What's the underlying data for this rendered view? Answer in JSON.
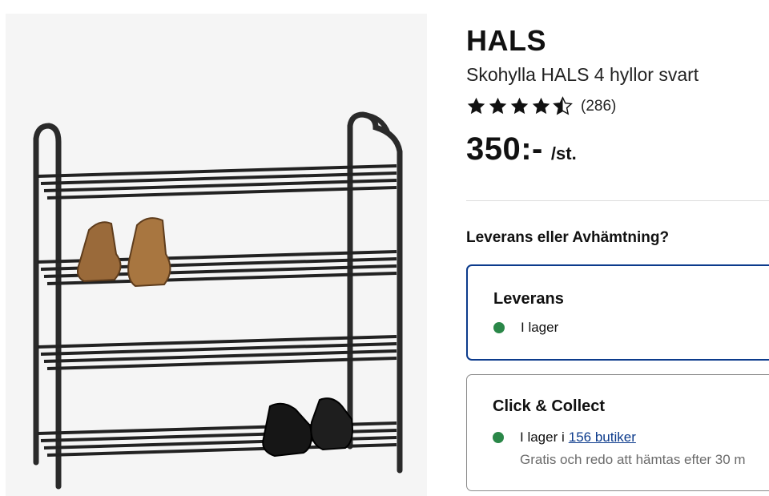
{
  "product": {
    "brand": "HALS",
    "name": "Skohylla HALS 4 hyllor svart",
    "rating": {
      "value": 4.5,
      "max": 5,
      "review_count": "(286)"
    },
    "price": {
      "amount": "350:-",
      "unit": "/st."
    },
    "image": {
      "icon": "shoe-rack-product-photo"
    }
  },
  "delivery": {
    "heading": "Leverans eller Avhämtning?",
    "options": [
      {
        "title": "Leverans",
        "status": "I lager",
        "selected": true
      },
      {
        "title": "Click & Collect",
        "status_prefix": "I lager i",
        "stores_link": "156 butiker",
        "note": "Gratis och redo att hämtas efter 30 m"
      }
    ]
  },
  "colors": {
    "accent": "#0c3b8c",
    "in_stock": "#2a8748",
    "text": "#111111",
    "muted": "#6b6b6b"
  }
}
